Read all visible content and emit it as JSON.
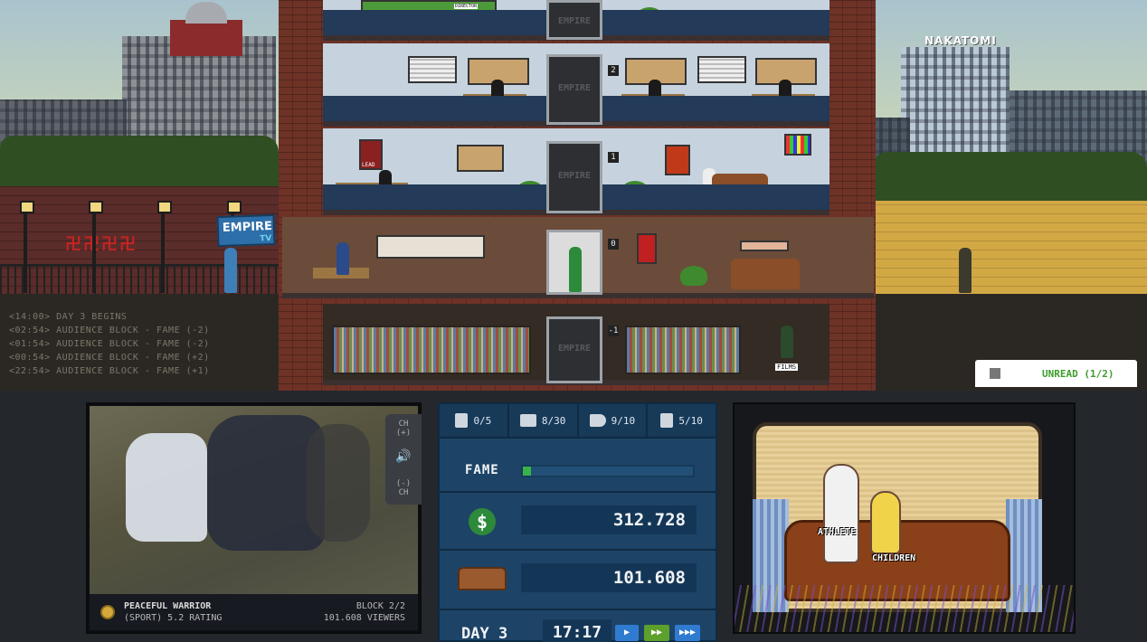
{
  "scene": {
    "tv_sign": "EMPIRE",
    "tv_sign_sub": "TV",
    "rival_tower": "NAKATOMI",
    "graffiti": "卍卍卍卍",
    "elevator_brand": "EMPIRE",
    "floor_numbers": [
      "2",
      "1",
      "0",
      "-1"
    ],
    "office_poster": "LEAD",
    "director_chair": "DIRECTOR",
    "archive_sign": "FILMS"
  },
  "event_log": [
    "<14:00> DAY 3 BEGINS",
    "<02:54> AUDIENCE BLOCK - FAME (-2)",
    "<01:54> AUDIENCE BLOCK - FAME (-2)",
    "<00:54> AUDIENCE BLOCK - FAME (+2)",
    "<22:54> AUDIENCE BLOCK - FAME (+1)"
  ],
  "unread": {
    "label": "UNREAD (1/2)"
  },
  "tv": {
    "channel_up": "CH\n(+)",
    "channel_down": "(-)\nCH",
    "show_title": "PEACEFUL WARRIOR",
    "show_meta": "(SPORT) 5.2 RATING",
    "block": "BLOCK 2/2",
    "viewers": "101.608 VIEWERS"
  },
  "stats": {
    "counters": [
      {
        "icon": "clipboard-icon",
        "value": "0/5"
      },
      {
        "icon": "clapperboard-icon",
        "value": "8/30"
      },
      {
        "icon": "megaphone-icon",
        "value": "9/10"
      },
      {
        "icon": "clipboard-icon",
        "value": "5/10"
      }
    ],
    "fame_label": "FAME",
    "fame_level": 0.05,
    "money_symbol": "$",
    "money": "312.728",
    "viewers": "101.608",
    "day": "DAY 3",
    "clock": "17:17",
    "speed_buttons": [
      "▶",
      "▶▶",
      "▶▶▶"
    ]
  },
  "audience": {
    "label_athlete": "ATHLETE",
    "label_children": "CHILDREN"
  },
  "colors": {
    "panel_blue": "#1d4466",
    "fame_green": "#38b24a",
    "unread_green": "#3d9c2a"
  }
}
